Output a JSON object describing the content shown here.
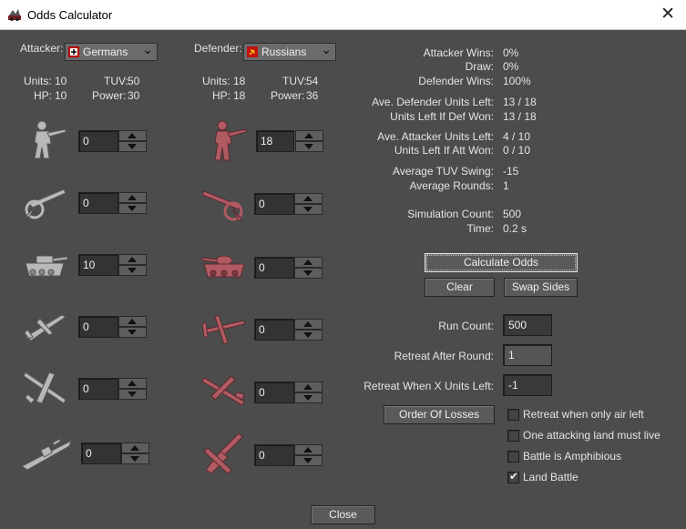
{
  "window": {
    "title": "Odds Calculator",
    "close_glyph": "✕",
    "app_icon": "odds-app-icon"
  },
  "colors": {
    "background": "#4c4c4c",
    "attacker_unit": "#b8b8b8",
    "defender_unit": "#b05a62",
    "text": "#e4e4e4"
  },
  "attacker": {
    "label": "Attacker:",
    "country": "Germans",
    "flag_icon": "german-flag-icon",
    "units_label": "Units:",
    "units": "10",
    "tuv_label": "TUV:",
    "tuv": "50",
    "hp_label": "HP:",
    "hp": "10",
    "power_label": "Power:",
    "power": "30",
    "rows": [
      {
        "unit": "infantry",
        "count": "0"
      },
      {
        "unit": "artillery",
        "count": "0"
      },
      {
        "unit": "armour",
        "count": "10"
      },
      {
        "unit": "fighter",
        "count": "0"
      },
      {
        "unit": "bomber",
        "count": "0"
      },
      {
        "unit": "battleship",
        "count": "0"
      }
    ]
  },
  "defender": {
    "label": "Defender:",
    "country": "Russians",
    "flag_icon": "soviet-flag-icon",
    "units_label": "Units:",
    "units": "18",
    "tuv_label": "TUV:",
    "tuv": "54",
    "hp_label": "HP:",
    "hp": "18",
    "power_label": "Power:",
    "power": "36",
    "rows": [
      {
        "unit": "infantry",
        "count": "18"
      },
      {
        "unit": "artillery",
        "count": "0"
      },
      {
        "unit": "armour",
        "count": "0"
      },
      {
        "unit": "fighter",
        "count": "0"
      },
      {
        "unit": "bomber",
        "count": "0"
      },
      {
        "unit": "aa-gun",
        "count": "0"
      }
    ]
  },
  "results": [
    {
      "label": "Attacker Wins:",
      "value": "0%"
    },
    {
      "label": "Draw:",
      "value": "0%"
    },
    {
      "label": "Defender Wins:",
      "value": "100%"
    },
    {
      "label": "Ave. Defender Units Left:",
      "value": "13 / 18"
    },
    {
      "label": "Units Left If Def Won:",
      "value": "13 / 18"
    },
    {
      "label": "Ave. Attacker Units Left:",
      "value": "4 / 10"
    },
    {
      "label": "Units Left If Att Won:",
      "value": "0 / 10"
    },
    {
      "label": "Average TUV Swing:",
      "value": "-15"
    },
    {
      "label": "Average Rounds:",
      "value": "1"
    },
    {
      "label": "Simulation Count:",
      "value": "500"
    },
    {
      "label": "Time:",
      "value": "0.2 s"
    }
  ],
  "buttons": {
    "calculate": "Calculate Odds",
    "clear": "Clear",
    "swap": "Swap Sides",
    "order_of_losses": "Order Of Losses",
    "close": "Close"
  },
  "settings": {
    "run_count_label": "Run Count:",
    "run_count": "500",
    "retreat_round_label": "Retreat After Round:",
    "retreat_round": "1",
    "retreat_units_label": "Retreat When X Units Left:",
    "retreat_units": "-1"
  },
  "checkboxes": [
    {
      "label": "Retreat when only air left",
      "checked": false
    },
    {
      "label": "One attacking land must live",
      "checked": false
    },
    {
      "label": "Battle is Amphibious",
      "checked": false
    },
    {
      "label": "Land Battle",
      "checked": true,
      "mark": "✔"
    }
  ],
  "combo_arrow": "⌄"
}
